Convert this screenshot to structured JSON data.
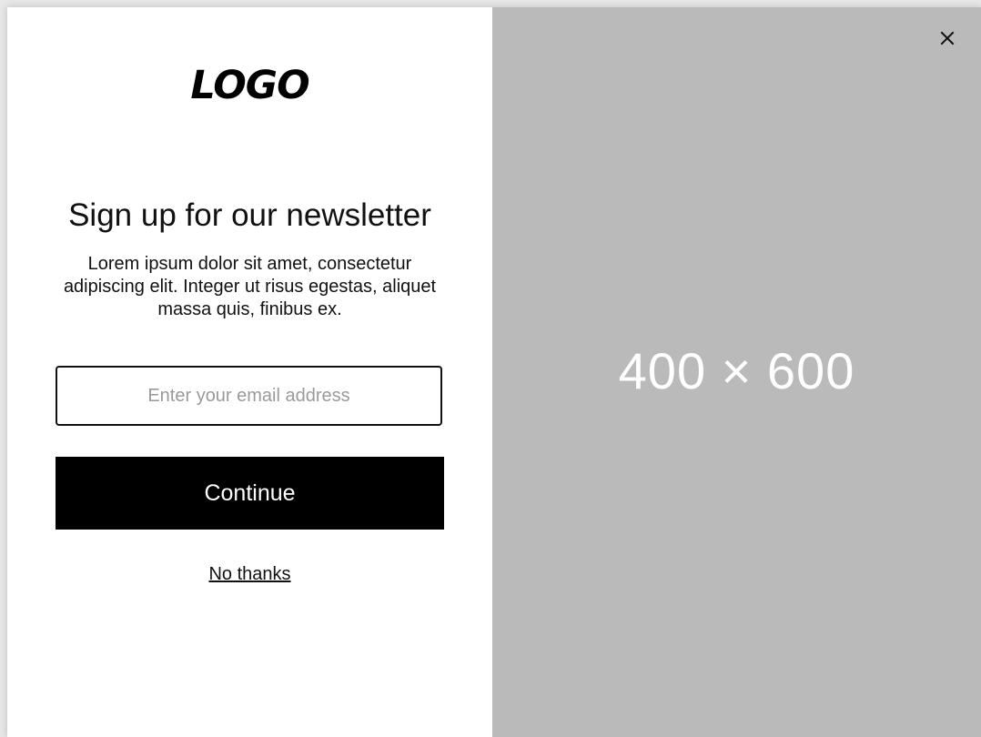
{
  "modal": {
    "logo_text": "LOGO",
    "title": "Sign up for our newsletter",
    "description": "Lorem ipsum dolor sit amet, consectetur adipiscing elit. Integer ut risus egestas, aliquet massa quis, finibus ex.",
    "email": {
      "placeholder": "Enter your email address",
      "value": ""
    },
    "continue_label": "Continue",
    "no_thanks_label": "No thanks",
    "image_placeholder": "400 × 600",
    "close_icon": "close-icon"
  },
  "colors": {
    "modal_background": "#ffffff",
    "image_background": "#bababa",
    "button_background": "#000000",
    "button_text": "#ffffff",
    "text": "#111111",
    "placeholder_text": "#9a9a9a"
  }
}
